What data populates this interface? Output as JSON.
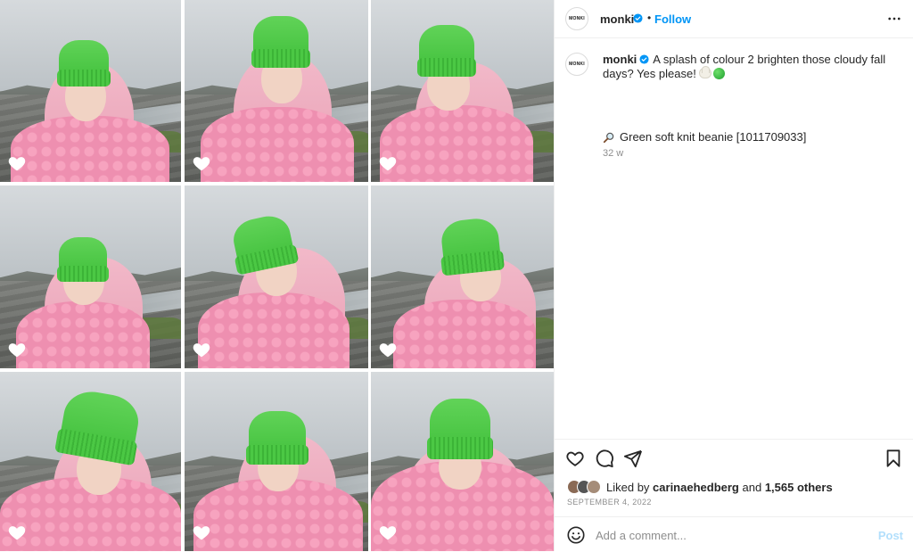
{
  "post": {
    "account": "monki",
    "avatar_text": "MONKI",
    "follow_label": "Follow",
    "separator": "•",
    "caption": {
      "username": "monki",
      "text": "A splash of colour 2 brighten those cloudy fall days? Yes please!",
      "product": "Green soft knit beanie [1011709033]",
      "time_ago": "32 w"
    },
    "likes": {
      "prefix": "Liked by",
      "user": "carinaehedberg",
      "connector": "and",
      "others": "1,565 others"
    },
    "date": "SEPTEMBER 4, 2022",
    "comment": {
      "placeholder": "Add a comment...",
      "post_label": "Post"
    }
  },
  "grid": {
    "photo_count": 9,
    "description_colors": {
      "hat": "#4cc845",
      "sweater": "#ee8fb0",
      "hair": "#f2b9c9"
    }
  },
  "icons": {
    "verified": "verified-badge-icon",
    "more": "more-options-icon",
    "like": "heart-icon",
    "comment": "comment-icon",
    "share": "send-icon",
    "save": "bookmark-icon",
    "emoji": "emoji-icon",
    "product": "magnifier-icon"
  },
  "colors": {
    "accent": "#0095f6",
    "post_disabled": "#b2dffc",
    "muted": "#8e8e8e",
    "text": "#262626"
  }
}
